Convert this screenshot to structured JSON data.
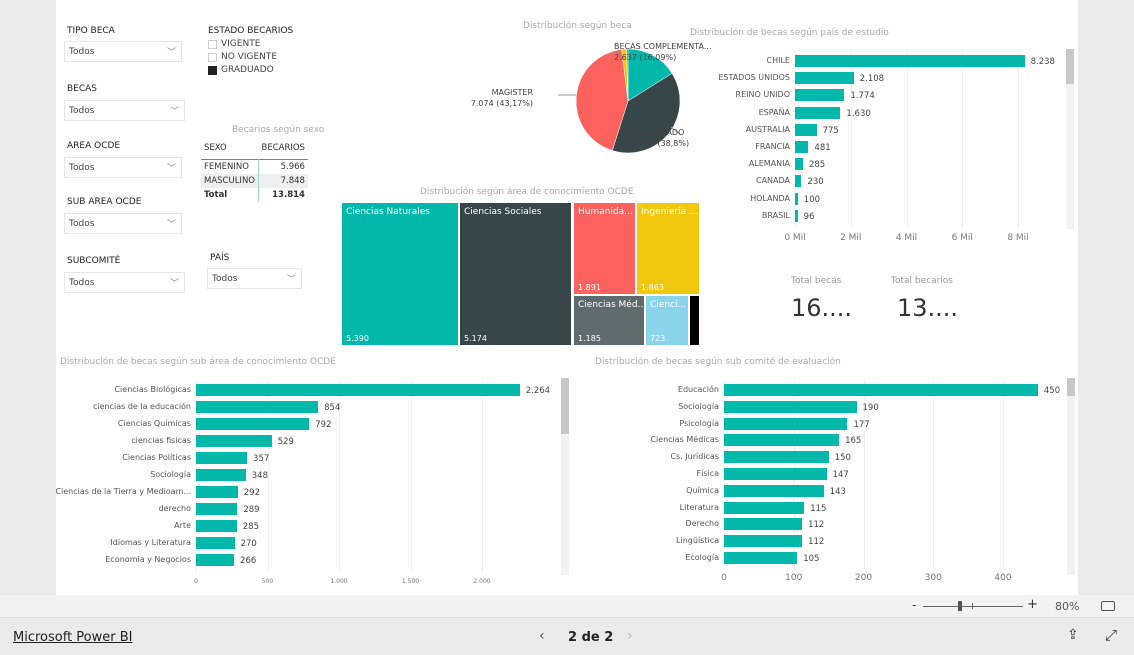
{
  "filters": {
    "tipo_beca": {
      "label": "TIPO BECA",
      "value": "Todos"
    },
    "becas": {
      "label": "BECAS",
      "value": "Todos"
    },
    "area_ocde": {
      "label": "AREA OCDE",
      "value": "Todos"
    },
    "sub_area_ocde": {
      "label": "SUB AREA OCDE",
      "value": "Todos"
    },
    "subcomite": {
      "label": "SUBCOMITÉ",
      "value": "Todos"
    },
    "pais": {
      "label": "PAÍS",
      "value": "Todos"
    },
    "estado": {
      "label": "ESTADO BECARIOS",
      "options": [
        {
          "label": "VIGENTE",
          "checked": false
        },
        {
          "label": "NO VIGENTE",
          "checked": false
        },
        {
          "label": "GRADUADO",
          "checked": true
        }
      ]
    }
  },
  "sexo_table": {
    "title": "Becarios según sexo",
    "headers": [
      "SEXO",
      "BECARIOS"
    ],
    "rows": [
      [
        "FEMENINO",
        "5.966"
      ],
      [
        "MASCULINO",
        "7.848"
      ]
    ],
    "total": [
      "Total",
      "13.814"
    ]
  },
  "kpis": {
    "total_becas": {
      "label": "Total becas",
      "value": "16...."
    },
    "total_becarios": {
      "label": "Total becarios",
      "value": "13...."
    }
  },
  "chart_data": [
    {
      "type": "pie",
      "title": "Distribución según beca",
      "slices": [
        {
          "label": "BECAS COMPLEMENTA...",
          "value": 2637,
          "text": "2.637 (16,09%)",
          "color": "#01b8aa"
        },
        {
          "label": "DOCTORADO",
          "value": 6358,
          "text": "6.358 (38,8%)",
          "color": "#374649"
        },
        {
          "label": "MAGISTER",
          "value": 7074,
          "text": "7.074 (43,17%)",
          "color": "#fd625e"
        },
        {
          "label": "",
          "value": 250,
          "text": "",
          "color": "#f2c80f"
        },
        {
          "label": "",
          "value": 70,
          "text": "",
          "color": "#5f6b6d"
        }
      ]
    },
    {
      "type": "bar",
      "title": "Distribución de becas según país de estudio",
      "categories": [
        "CHILE",
        "ESTADOS UNIDOS",
        "REINO UNIDO",
        "ESPAÑA",
        "AUSTRALIA",
        "FRANCIA",
        "ALEMANIA",
        "CANADA",
        "HOLANDA",
        "BRASIL"
      ],
      "values": [
        8238,
        2108,
        1774,
        1630,
        775,
        481,
        285,
        230,
        100,
        96
      ],
      "value_labels": [
        "8.238",
        "2.108",
        "1.774",
        "1.630",
        "775",
        "481",
        "285",
        "230",
        "100",
        "96"
      ],
      "ticks": [
        0,
        2000,
        4000,
        6000,
        8000
      ],
      "tick_labels": [
        "0 Mil",
        "2 Mil",
        "4 Mil",
        "6 Mil",
        "8 Mil"
      ],
      "color": "#01b8aa"
    },
    {
      "type": "treemap",
      "title": "Distribución según área de conocimiento OCDE",
      "items": [
        {
          "label": "Ciencias Naturales",
          "value": "5.390",
          "color": "#01b8aa"
        },
        {
          "label": "Ciencias Sociales",
          "value": "5.174",
          "color": "#374649"
        },
        {
          "label": "Humanida...",
          "value": "1.891",
          "color": "#fd625e"
        },
        {
          "label": "Ingeniería ...",
          "value": "1.863",
          "color": "#f2c80f"
        },
        {
          "label": "Ciencias Méd...",
          "value": "1.185",
          "color": "#5f6b6d"
        },
        {
          "label": "Cienci...",
          "value": "723",
          "color": "#8ad4eb"
        },
        {
          "label": "",
          "value": "",
          "color": "#000000"
        }
      ]
    },
    {
      "type": "bar",
      "title": "Distribución de becas según sub área de conocimiento OCDE",
      "categories": [
        "Ciencias Biológicas",
        "ciencias de la educación",
        "Ciencias Químicas",
        "ciencias fisicas",
        "Ciencias Políticas",
        "Sociología",
        "Ciencias de la Tierra y Medioam...",
        "derecho",
        "Arte",
        "Idiomas y Literatura",
        "Economia y Negocios"
      ],
      "values": [
        2264,
        854,
        792,
        529,
        357,
        348,
        292,
        289,
        285,
        270,
        266
      ],
      "value_labels": [
        "2.264",
        "854",
        "792",
        "529",
        "357",
        "348",
        "292",
        "289",
        "285",
        "270",
        "266"
      ],
      "ticks": [
        0,
        500,
        1000,
        1500,
        2000
      ],
      "tick_labels": [
        "0",
        "500",
        "1.000",
        "1.500",
        "2.000"
      ],
      "color": "#01b8aa"
    },
    {
      "type": "bar",
      "title": "Distribución de becas según sub comité de evaluación",
      "categories": [
        "Educación",
        "Sociología",
        "Psicología",
        "Ciencias Médicas",
        "Cs. Jurídicas",
        "Física",
        "Química",
        "Literatura",
        "Derecho",
        "Lingüística",
        "Ecología"
      ],
      "values": [
        450,
        190,
        177,
        165,
        150,
        147,
        143,
        115,
        112,
        112,
        105
      ],
      "value_labels": [
        "450",
        "190",
        "177",
        "165",
        "150",
        "147",
        "143",
        "115",
        "112",
        "112",
        "105"
      ],
      "ticks": [
        0,
        100,
        200,
        300,
        400
      ],
      "tick_labels": [
        "0",
        "100",
        "200",
        "300",
        "400"
      ],
      "color": "#01b8aa"
    }
  ],
  "zoom": {
    "minus": "-",
    "plus": "+",
    "level": "80%",
    "percent": 80
  },
  "footer": {
    "brand": "Microsoft Power BI",
    "page": "2 de 2"
  }
}
